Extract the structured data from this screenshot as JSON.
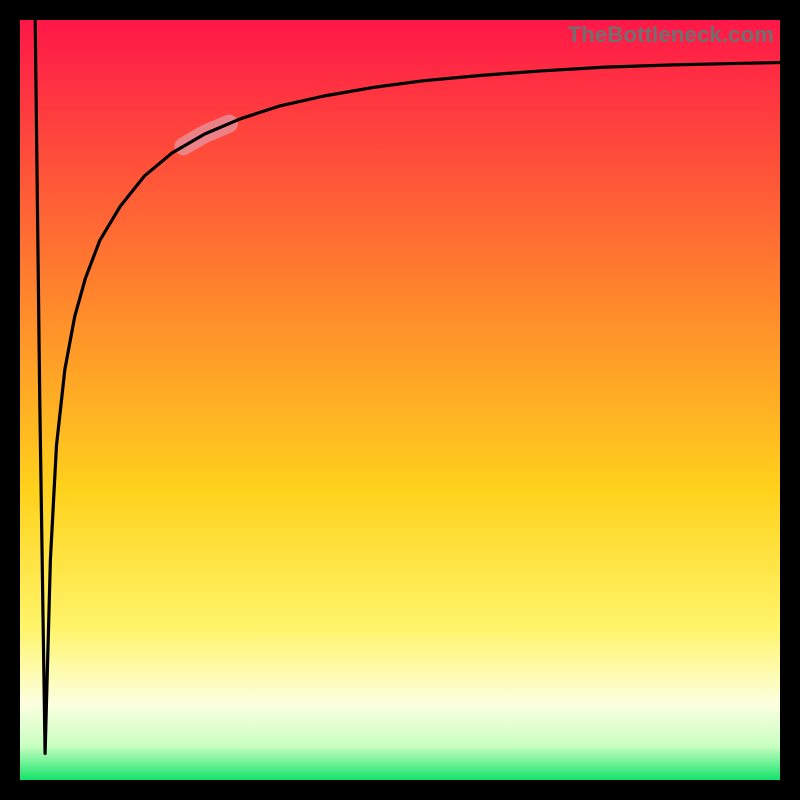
{
  "watermark": "TheBottleneck.com",
  "chart_data": {
    "type": "line",
    "title": "",
    "xlabel": "",
    "ylabel": "",
    "xlim": [
      0,
      100
    ],
    "ylim": [
      0,
      100
    ],
    "grid": false,
    "legend": false,
    "gradient_stops": [
      {
        "offset": 0.0,
        "color": "#ff1748"
      },
      {
        "offset": 0.38,
        "color": "#ff8a2b"
      },
      {
        "offset": 0.62,
        "color": "#ffd21c"
      },
      {
        "offset": 0.8,
        "color": "#fff56a"
      },
      {
        "offset": 0.9,
        "color": "#fcffe0"
      },
      {
        "offset": 0.955,
        "color": "#c9ffc0"
      },
      {
        "offset": 1.0,
        "color": "#15e36b"
      }
    ],
    "series": [
      {
        "name": "bottleneck-curve",
        "note": "y is percentage from top of plot (0 = top, 100 = bottom)",
        "x": [
          2.0,
          2.6,
          3.3,
          4.0,
          4.8,
          5.9,
          7.2,
          8.6,
          10.5,
          13.2,
          16.4,
          20.0,
          24.3,
          29.0,
          34.2,
          40.0,
          46.3,
          53.0,
          60.5,
          68.5,
          77.0,
          86.0,
          95.0,
          100.0
        ],
        "y": [
          0.0,
          50.0,
          96.5,
          71.0,
          56.0,
          46.0,
          39.0,
          34.0,
          29.0,
          24.5,
          20.5,
          17.5,
          15.0,
          13.0,
          11.3,
          10.0,
          8.9,
          8.0,
          7.3,
          6.7,
          6.2,
          5.9,
          5.7,
          5.6
        ]
      }
    ],
    "highlight": {
      "note": "soft pink overlay segment on curve",
      "x_range": [
        21.5,
        27.5
      ]
    }
  }
}
